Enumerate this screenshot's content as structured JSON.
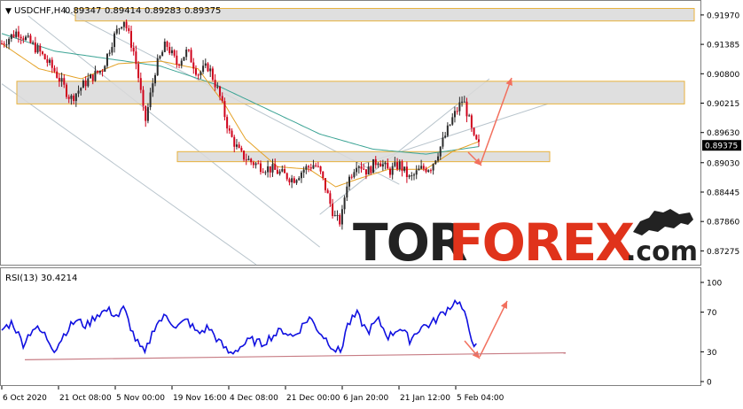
{
  "header": {
    "symbol": "USDCHF,H4",
    "open": "0.89347",
    "high": "0.89414",
    "low": "0.89283",
    "close": "0.89375"
  },
  "rsi_label": "RSI(13) 30.4214",
  "watermark": {
    "part1": "TOR",
    "part2": "FOREX",
    "part3": ".com"
  },
  "colors": {
    "candle_up": "#2b2b2b",
    "candle_down": "#d0021b",
    "ma_slow": "#3aa394",
    "ma_fast": "#e4a125",
    "zone_fill": "#d9d9d9",
    "zone_border": "#e8b23c",
    "rsi_line": "#1010e0",
    "arrow": "#f2705e",
    "channel": "#b8c4cc",
    "logo_red": "#e0331b",
    "logo_dark": "#222222"
  },
  "chart_data": {
    "type": "candlestick",
    "instrument": "USDCHF",
    "timeframe": "H4",
    "price_ticks": [
      "0.91970",
      "0.91385",
      "0.90800",
      "0.90215",
      "0.89630",
      "0.89030",
      "0.88445",
      "0.87860",
      "0.87275"
    ],
    "current_price": "0.89375",
    "price_range": [
      0.87,
      0.9225
    ],
    "x_labels": [
      "6 Oct 2020",
      "21 Oct 08:00",
      "5 Nov 00:00",
      "19 Nov 16:00",
      "4 Dec 08:00",
      "21 Dec 00:00",
      "6 Jan 20:00",
      "21 Jan 12:00",
      "5 Feb 04:00"
    ],
    "price_path": [
      [
        0,
        0.914
      ],
      [
        3,
        0.9165
      ],
      [
        7,
        0.9125
      ],
      [
        10,
        0.9085
      ],
      [
        13,
        0.903
      ],
      [
        16,
        0.9065
      ],
      [
        19,
        0.909
      ],
      [
        21,
        0.915
      ],
      [
        23,
        0.919
      ],
      [
        25,
        0.912
      ],
      [
        26,
        0.906
      ],
      [
        27,
        0.898
      ],
      [
        29,
        0.909
      ],
      [
        31,
        0.914
      ],
      [
        33,
        0.91
      ],
      [
        35,
        0.9125
      ],
      [
        37,
        0.908
      ],
      [
        39,
        0.9095
      ],
      [
        41,
        0.904
      ],
      [
        43,
        0.896
      ],
      [
        45,
        0.892
      ],
      [
        47,
        0.8905
      ],
      [
        49,
        0.8895
      ],
      [
        51,
        0.889
      ],
      [
        53,
        0.888
      ],
      [
        55,
        0.887
      ],
      [
        57,
        0.889
      ],
      [
        59,
        0.89
      ],
      [
        60,
        0.8885
      ],
      [
        61,
        0.8855
      ],
      [
        62,
        0.882
      ],
      [
        63,
        0.879
      ],
      [
        64,
        0.8785
      ],
      [
        65,
        0.886
      ],
      [
        67,
        0.8905
      ],
      [
        69,
        0.8885
      ],
      [
        71,
        0.891
      ],
      [
        73,
        0.8885
      ],
      [
        75,
        0.89
      ],
      [
        77,
        0.887
      ],
      [
        79,
        0.889
      ],
      [
        81,
        0.8895
      ],
      [
        83,
        0.894
      ],
      [
        85,
        0.899
      ],
      [
        87,
        0.903
      ],
      [
        88,
        0.8995
      ],
      [
        89,
        0.895
      ],
      [
        90,
        0.8937
      ]
    ],
    "ma_slow": [
      [
        0,
        0.916
      ],
      [
        10,
        0.9125
      ],
      [
        20,
        0.911
      ],
      [
        30,
        0.9095
      ],
      [
        40,
        0.906
      ],
      [
        50,
        0.901
      ],
      [
        60,
        0.896
      ],
      [
        70,
        0.893
      ],
      [
        80,
        0.892
      ],
      [
        90,
        0.8935
      ]
    ],
    "ma_fast": [
      [
        0,
        0.914
      ],
      [
        7,
        0.909
      ],
      [
        15,
        0.907
      ],
      [
        22,
        0.91
      ],
      [
        30,
        0.9105
      ],
      [
        37,
        0.909
      ],
      [
        42,
        0.902
      ],
      [
        46,
        0.895
      ],
      [
        52,
        0.8895
      ],
      [
        58,
        0.889
      ],
      [
        63,
        0.8855
      ],
      [
        67,
        0.887
      ],
      [
        73,
        0.889
      ],
      [
        80,
        0.889
      ],
      [
        85,
        0.8925
      ],
      [
        90,
        0.8945
      ]
    ],
    "resistance_zones": [
      {
        "from": 0.9185,
        "to": 0.921
      },
      {
        "from": 0.902,
        "to": 0.9065
      },
      {
        "from": 0.8905,
        "to": 0.8925
      }
    ],
    "rsi": {
      "period": 13,
      "last": 30.4214,
      "levels": [
        100,
        70,
        30,
        0
      ],
      "values": [
        [
          0,
          52
        ],
        [
          2,
          60
        ],
        [
          4,
          38
        ],
        [
          6,
          55
        ],
        [
          8,
          48
        ],
        [
          10,
          32
        ],
        [
          12,
          50
        ],
        [
          14,
          62
        ],
        [
          16,
          56
        ],
        [
          18,
          68
        ],
        [
          20,
          72
        ],
        [
          22,
          66
        ],
        [
          23,
          74
        ],
        [
          25,
          45
        ],
        [
          26,
          35
        ],
        [
          27,
          28
        ],
        [
          29,
          58
        ],
        [
          31,
          66
        ],
        [
          33,
          55
        ],
        [
          35,
          62
        ],
        [
          37,
          48
        ],
        [
          39,
          55
        ],
        [
          41,
          40
        ],
        [
          43,
          28
        ],
        [
          45,
          35
        ],
        [
          47,
          42
        ],
        [
          49,
          38
        ],
        [
          51,
          46
        ],
        [
          53,
          52
        ],
        [
          55,
          45
        ],
        [
          57,
          58
        ],
        [
          58,
          65
        ],
        [
          60,
          50
        ],
        [
          62,
          38
        ],
        [
          63,
          32
        ],
        [
          64,
          30
        ],
        [
          65,
          55
        ],
        [
          67,
          68
        ],
        [
          69,
          50
        ],
        [
          71,
          62
        ],
        [
          73,
          45
        ],
        [
          75,
          55
        ],
        [
          77,
          42
        ],
        [
          79,
          55
        ],
        [
          81,
          58
        ],
        [
          83,
          68
        ],
        [
          85,
          78
        ],
        [
          86,
          82
        ],
        [
          87,
          72
        ],
        [
          88,
          55
        ],
        [
          89,
          40
        ],
        [
          90,
          30
        ]
      ]
    }
  }
}
